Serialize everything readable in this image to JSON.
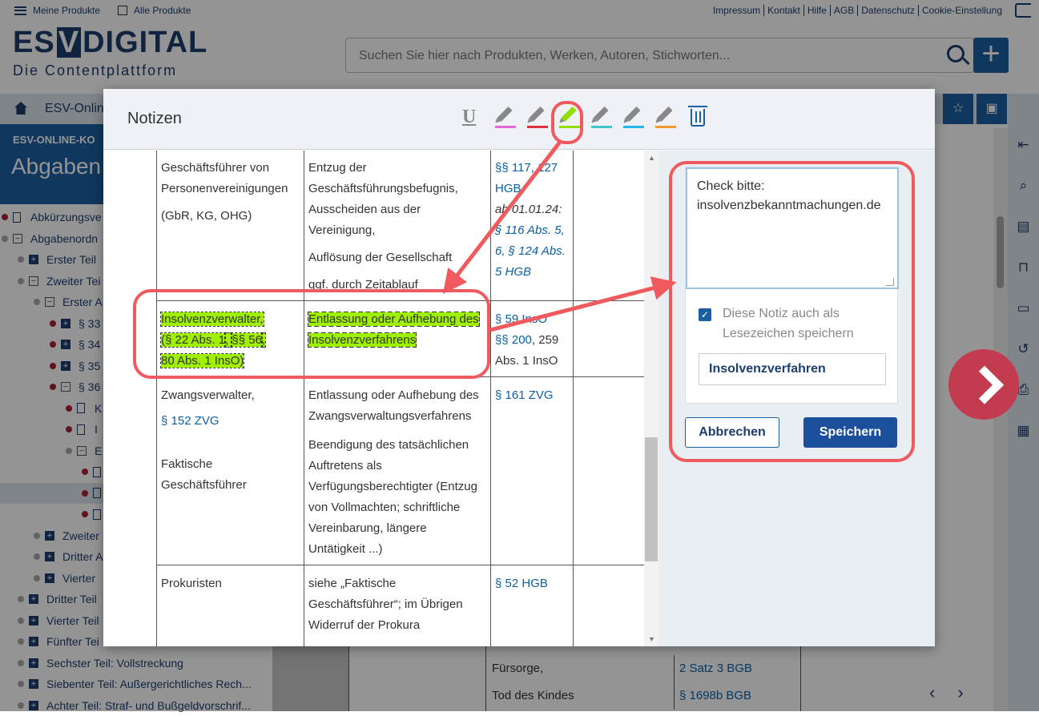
{
  "topbar": {
    "my_products": "Meine Produkte",
    "all_products": "Alle Produkte",
    "links": [
      "Impressum",
      "Kontakt",
      "Hilfe",
      "AGB",
      "Datenschutz",
      "Cookie-Einstellung"
    ]
  },
  "logo": {
    "line1_a": "ES",
    "line1_v": "V",
    "line1_b": "DIGITAL",
    "line2": "Die Contentplattform"
  },
  "search": {
    "placeholder": "Suchen Sie hier nach Produkten, Werken, Autoren, Stichworten..."
  },
  "breadcrumb": {
    "item": "ESV-Onlin"
  },
  "banner": {
    "kicker": "ESV-ONLINE-KO",
    "title": "Abgaben"
  },
  "tree": [
    {
      "label": "Abkürzungsve",
      "kind": "doc",
      "dot": "red",
      "indent": 0
    },
    {
      "label": "Abgabenordn",
      "kind": "minus",
      "dot": "grey",
      "indent": 0
    },
    {
      "label": "Erster Teil",
      "kind": "plus",
      "dot": "grey",
      "indent": 1
    },
    {
      "label": "Zweiter Tei",
      "kind": "minus",
      "dot": "grey",
      "indent": 1
    },
    {
      "label": "Erster A",
      "kind": "minus",
      "dot": "grey",
      "indent": 2
    },
    {
      "label": "§ 33",
      "kind": "plus",
      "dot": "red",
      "indent": 3
    },
    {
      "label": "§ 34",
      "kind": "plus",
      "dot": "red",
      "indent": 3
    },
    {
      "label": "§ 35",
      "kind": "plus",
      "dot": "red",
      "indent": 3
    },
    {
      "label": "§ 36",
      "kind": "minus",
      "dot": "red",
      "indent": 3
    },
    {
      "label": "K",
      "kind": "doc",
      "dot": "red",
      "indent": 4
    },
    {
      "label": "I",
      "kind": "doc",
      "dot": "red",
      "indent": 4
    },
    {
      "label": "E",
      "kind": "minus",
      "dot": "grey",
      "indent": 4
    },
    {
      "label": "",
      "kind": "doc",
      "dot": "red",
      "indent": 5
    },
    {
      "label": "",
      "kind": "doc",
      "dot": "red",
      "indent": 5,
      "selected": true
    },
    {
      "label": "",
      "kind": "doc",
      "dot": "red",
      "indent": 5
    },
    {
      "label": "Zweiter",
      "kind": "plus",
      "dot": "grey",
      "indent": 2
    },
    {
      "label": "Dritter A",
      "kind": "plus",
      "dot": "grey",
      "indent": 2
    },
    {
      "label": "Vierter",
      "kind": "plus",
      "dot": "grey",
      "indent": 2
    },
    {
      "label": "Dritter Teil",
      "kind": "plus",
      "dot": "grey",
      "indent": 1
    },
    {
      "label": "Vierter Teil",
      "kind": "plus",
      "dot": "grey",
      "indent": 1
    },
    {
      "label": "Fünfter Tei",
      "kind": "plus",
      "dot": "grey",
      "indent": 1
    },
    {
      "label": "Sechster Teil: Vollstreckung",
      "kind": "plus",
      "dot": "grey",
      "indent": 1
    },
    {
      "label": "Siebenter Teil: Außergerichtliches Rech...",
      "kind": "plus",
      "dot": "grey",
      "indent": 1
    },
    {
      "label": "Achter Teil: Straf- und Bußgeldvorschrif...",
      "kind": "plus",
      "dot": "grey",
      "indent": 1
    }
  ],
  "background_table": {
    "col1": [
      "Fürsorge,",
      "Tod des Kindes"
    ],
    "col2": [
      "2 Satz 3 BGB",
      "§ 1698b BGB"
    ]
  },
  "modal": {
    "title": "Notizen",
    "tools": [
      {
        "name": "underline-tool",
        "glyph": "U"
      },
      {
        "name": "highlight-pink",
        "color": "#e06ad6"
      },
      {
        "name": "highlight-red",
        "color": "#e0313a"
      },
      {
        "name": "highlight-green",
        "color": "#8fe000",
        "active": true
      },
      {
        "name": "highlight-teal",
        "color": "#3ec7c9"
      },
      {
        "name": "highlight-cyan",
        "color": "#21b8e8"
      },
      {
        "name": "highlight-orange",
        "color": "#f09a2c"
      }
    ],
    "rows": [
      {
        "c1": [
          "Geschäftsführer von Personenvereinigungen",
          "(GbR, KG, OHG)"
        ],
        "c2": [
          "Entzug der Geschäftsführungsbefugnis, Ausscheiden aus der Vereinigung,",
          "Auflösung der Gesellschaft",
          "ggf. durch Zeitablauf"
        ],
        "c3_a": "§§ 117, 127 HGB",
        "c3_b": "ab 01.01.24:",
        "c3_c": "§ 116 Abs. 5, 6, § 124 Abs. 5 HGB"
      },
      {
        "c1_a": "Insolvenzverwalter,",
        "c1_b": "(§ 22 Abs. 1",
        "c1_c": ", ",
        "c1_d": "§§ 56",
        "c1_e": ",",
        "c1_f": "80 Abs. 1 InsO)",
        "c2": "Entlassung oder Aufhebung des Insolvenzverfahrens",
        "c3_a": "§ 59 InsO",
        "c3_b": "§§ 200",
        "c3_c": ", 259 Abs. 1 InsO"
      },
      {
        "c1_a": "Zwangsverwalter,",
        "c1_b": "§ 152 ZVG",
        "c1_c": "Faktische Geschäftsführer",
        "c2_a": "Entlassung oder Aufhebung des Zwangsverwaltungsverfahrens",
        "c2_b": "Beendigung des tatsächlichen Auftretens als Verfügungsberechtigter (Entzug von Vollmachten; schriftliche Vereinbarung, längere Untätigkeit ...)",
        "c3": "§ 161 ZVG"
      },
      {
        "c1": "Prokuristen",
        "c2": "siehe „Faktische Geschäftsführer“; im Übrigen Widerruf der Prokura",
        "c3": "§ 52 HGB"
      }
    ],
    "note": {
      "text": "Check bitte: insolvenzbekanntmachungen.de",
      "bookmark_checked": true,
      "bookmark_label": "Diese Notiz auch als Lesezeichen speichern",
      "bookmark_name": "Insolvenzverfahren",
      "cancel": "Abbrechen",
      "save": "Speichern"
    }
  },
  "colors": {
    "brand": "#1c3f6e",
    "accent": "#1c5fa0",
    "highlight": "#9ef000",
    "annotation": "#f05a5e"
  }
}
